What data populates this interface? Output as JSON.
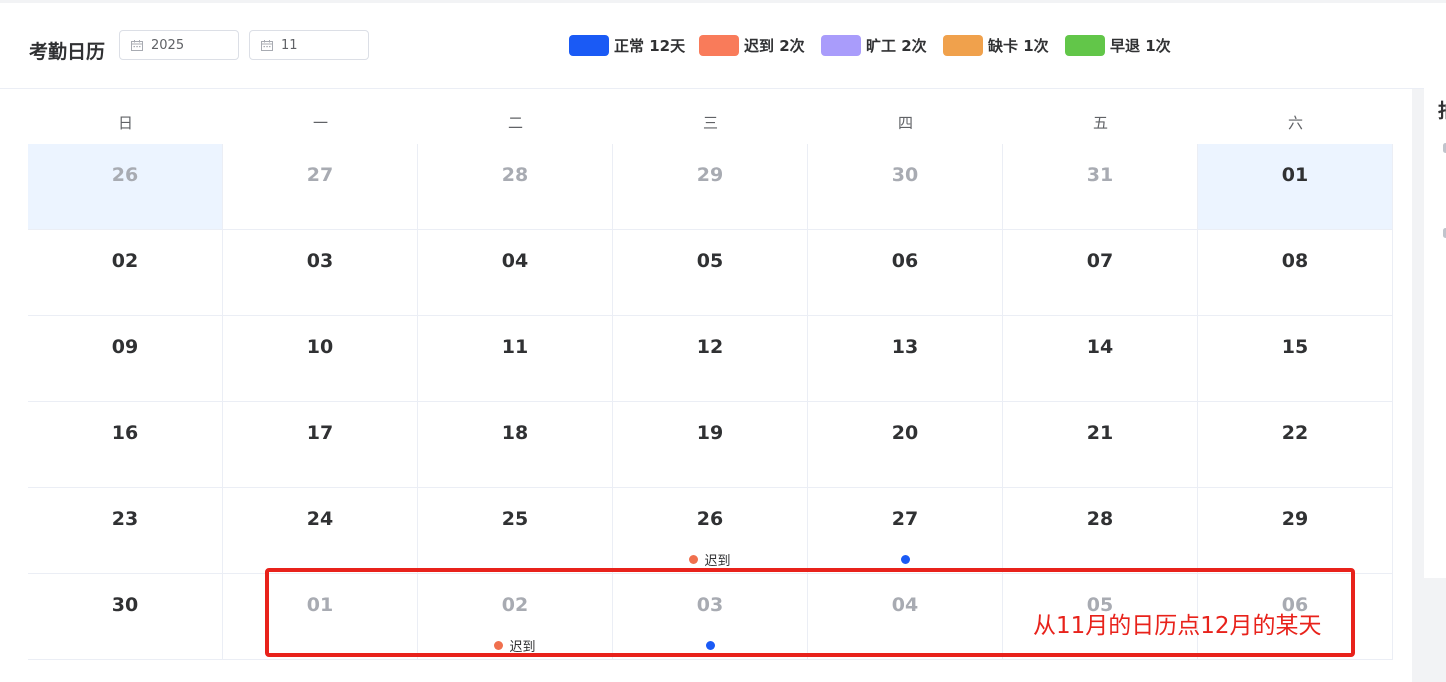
{
  "header": {
    "title": "考勤日历",
    "year_value": "2025",
    "month_value": "11"
  },
  "legend": [
    {
      "label": "正常 12天",
      "color": "#1a5af5"
    },
    {
      "label": "迟到 2次",
      "color": "#f97b5a"
    },
    {
      "label": "旷工 2次",
      "color": "#a99cfb"
    },
    {
      "label": "缺卡 1次",
      "color": "#f0a14c"
    },
    {
      "label": "早退 1次",
      "color": "#62c649"
    }
  ],
  "right_panel_text": "拍",
  "weekdays": [
    "日",
    "一",
    "二",
    "三",
    "四",
    "五",
    "六"
  ],
  "weeks": [
    [
      {
        "day": "26",
        "other": true,
        "hl": true
      },
      {
        "day": "27",
        "other": true
      },
      {
        "day": "28",
        "other": true
      },
      {
        "day": "29",
        "other": true
      },
      {
        "day": "30",
        "other": true
      },
      {
        "day": "31",
        "other": true
      },
      {
        "day": "01",
        "hl": true
      }
    ],
    [
      {
        "day": "02"
      },
      {
        "day": "03"
      },
      {
        "day": "04"
      },
      {
        "day": "05"
      },
      {
        "day": "06"
      },
      {
        "day": "07"
      },
      {
        "day": "08"
      }
    ],
    [
      {
        "day": "09"
      },
      {
        "day": "10"
      },
      {
        "day": "11"
      },
      {
        "day": "12"
      },
      {
        "day": "13"
      },
      {
        "day": "14"
      },
      {
        "day": "15"
      }
    ],
    [
      {
        "day": "16"
      },
      {
        "day": "17"
      },
      {
        "day": "18"
      },
      {
        "day": "19"
      },
      {
        "day": "20"
      },
      {
        "day": "21"
      },
      {
        "day": "22"
      }
    ],
    [
      {
        "day": "23"
      },
      {
        "day": "24"
      },
      {
        "day": "25"
      },
      {
        "day": "26",
        "mark": {
          "color": "#f0704e",
          "text": "迟到"
        }
      },
      {
        "day": "27",
        "mark": {
          "color": "#1a5af5",
          "text": ""
        }
      },
      {
        "day": "28"
      },
      {
        "day": "29"
      }
    ],
    [
      {
        "day": "30"
      },
      {
        "day": "01",
        "other": true
      },
      {
        "day": "02",
        "other": true,
        "mark": {
          "color": "#f0704e",
          "text": "迟到"
        }
      },
      {
        "day": "03",
        "other": true,
        "mark": {
          "color": "#1a5af5",
          "text": ""
        }
      },
      {
        "day": "04",
        "other": true
      },
      {
        "day": "05",
        "other": true
      },
      {
        "day": "06",
        "other": true
      }
    ]
  ],
  "annotation": {
    "text": "从11月的日历点12月的某天",
    "color": "#e8221b"
  }
}
